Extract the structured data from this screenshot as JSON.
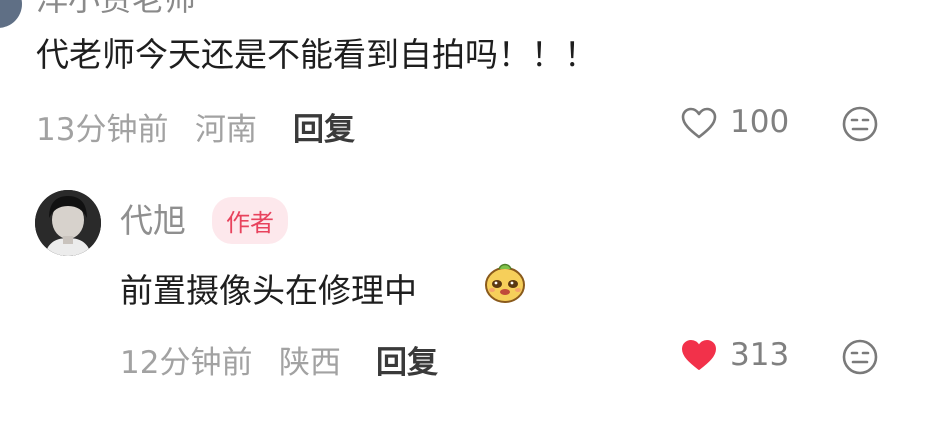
{
  "top_comment": {
    "username_cut": "洋小贾老师",
    "text": "代老师今天还是不能看到自拍吗！！！",
    "time": "13分钟前",
    "location": "河南",
    "reply_label": "回复",
    "likes": "100",
    "liked": false
  },
  "author_reply": {
    "username": "代旭",
    "badge": "作者",
    "text": "前置摄像头在修理中",
    "emoji_icon": "smiling-blob-emoji-icon",
    "time": "12分钟前",
    "location": "陕西",
    "reply_label": "回复",
    "likes": "313",
    "liked": true
  },
  "colors": {
    "like_active": "#f2314a",
    "badge_bg": "#fde8ec",
    "badge_text": "#e8435d",
    "meta_text": "#a2a2a2"
  }
}
